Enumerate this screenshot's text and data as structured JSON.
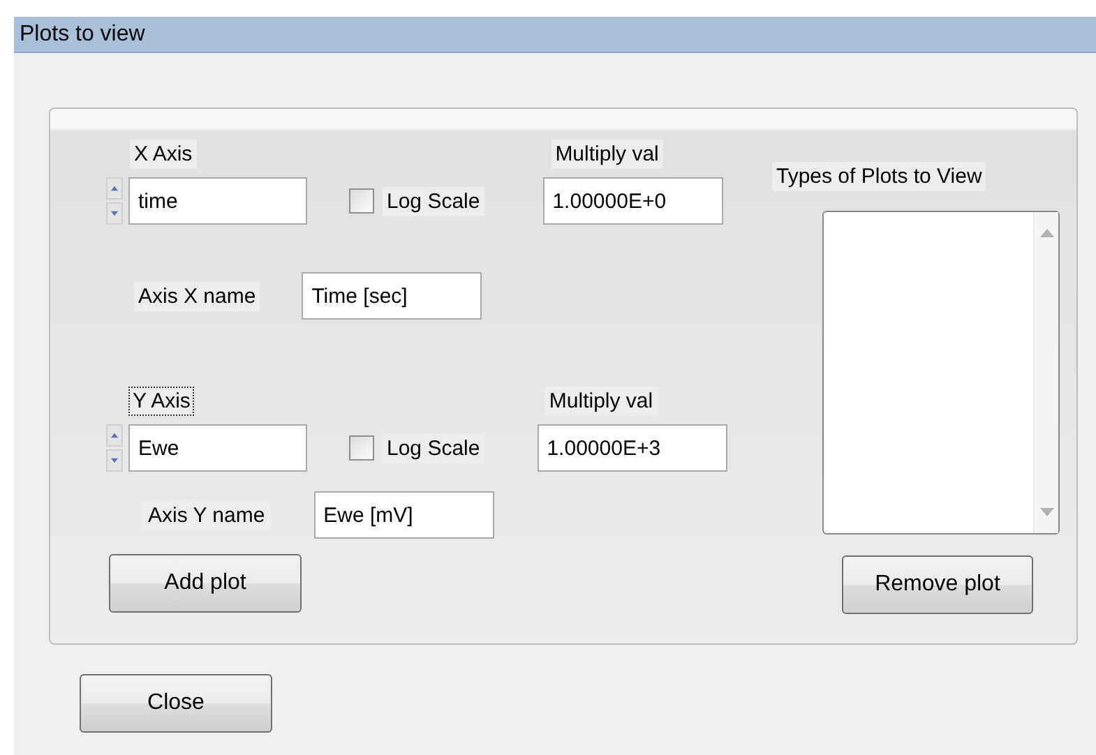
{
  "window": {
    "title": "Plots to view"
  },
  "axes": [
    {
      "label": "X Axis",
      "focused": false,
      "value": "time",
      "log_scale": {
        "label": "Log Scale",
        "checked": false
      },
      "multiply_label": "Multiply val",
      "multiply_value": "1.00000E+0",
      "name_label": "Axis X name",
      "name_value": "Time [sec]"
    },
    {
      "label": "Y Axis",
      "focused": true,
      "value": "Ewe",
      "log_scale": {
        "label": "Log Scale",
        "checked": false
      },
      "multiply_label": "Multiply val",
      "multiply_value": "1.00000E+3",
      "name_label": "Axis Y name",
      "name_value": "Ewe [mV]"
    }
  ],
  "plot_types": {
    "label": "Types of Plots to View"
  },
  "buttons": {
    "add": "Add plot",
    "remove": "Remove plot",
    "close": "Close"
  }
}
